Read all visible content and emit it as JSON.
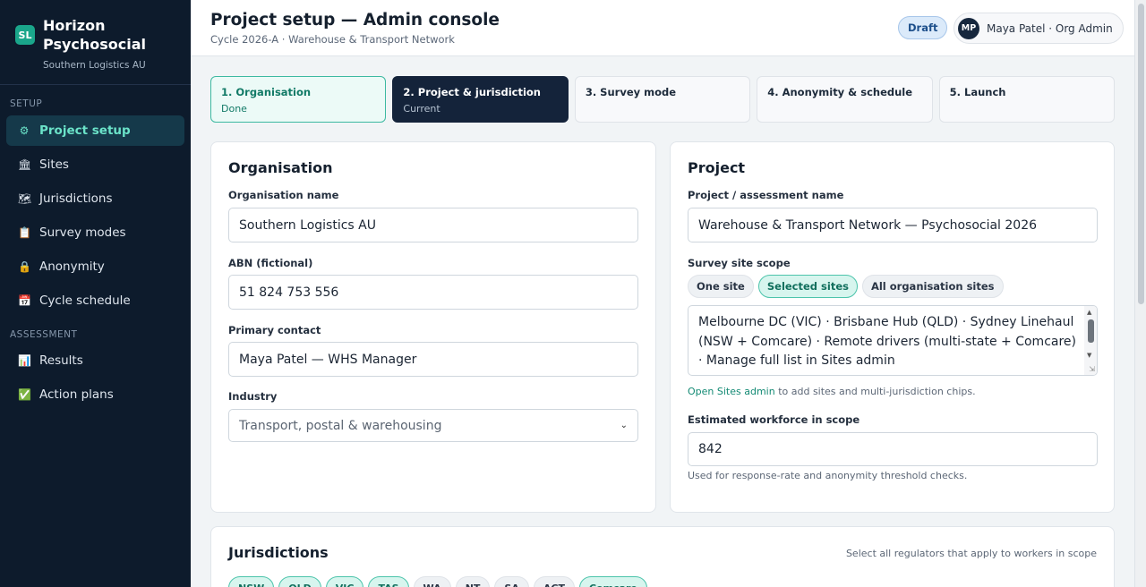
{
  "brand": {
    "logo": "SL",
    "name": "Horizon Psychosocial",
    "org": "Southern Logistics AU"
  },
  "sidebar": {
    "setup_section": "SETUP",
    "assessment_section": "ASSESSMENT",
    "setup_items": [
      {
        "label": "Project setup",
        "icon": "gear-icon",
        "glyph": "⚙",
        "active": true
      },
      {
        "label": "Sites",
        "icon": "building-icon",
        "glyph": "🏛"
      },
      {
        "label": "Jurisdictions",
        "icon": "map-icon",
        "glyph": "🗺"
      },
      {
        "label": "Survey modes",
        "icon": "clipboard-icon",
        "glyph": "📋"
      },
      {
        "label": "Anonymity",
        "icon": "lock-icon",
        "glyph": "🔒"
      },
      {
        "label": "Cycle schedule",
        "icon": "calendar-icon",
        "glyph": "📅"
      }
    ],
    "assessment_items": [
      {
        "label": "Results",
        "icon": "chart-icon",
        "glyph": "📊"
      },
      {
        "label": "Action plans",
        "icon": "check-icon",
        "glyph": "✅"
      }
    ]
  },
  "header": {
    "title": "Project setup — Admin console",
    "subtitle": "Cycle 2026-A · Warehouse & Transport Network",
    "status_badge": "Draft",
    "user_initials": "MP",
    "user_label": "Maya Patel · Org Admin"
  },
  "steps": [
    {
      "title": "1. Organisation",
      "status": "Done",
      "state": "done"
    },
    {
      "title": "2. Project & jurisdiction",
      "status": "Current",
      "state": "current"
    },
    {
      "title": "3. Survey mode",
      "status": "",
      "state": ""
    },
    {
      "title": "4. Anonymity & schedule",
      "status": "",
      "state": ""
    },
    {
      "title": "5. Launch",
      "status": "",
      "state": ""
    }
  ],
  "organisation": {
    "title": "Organisation",
    "name_label": "Organisation name",
    "name_value": "Southern Logistics AU",
    "abn_label": "ABN (fictional)",
    "abn_value": "51 824 753 556",
    "contact_label": "Primary contact",
    "contact_value": "Maya Patel — WHS Manager",
    "industry_label": "Industry",
    "industry_value": "Transport, postal & warehousing"
  },
  "project": {
    "title": "Project",
    "name_label": "Project / assessment name",
    "name_value": "Warehouse & Transport Network — Psychosocial 2026",
    "scope_label": "Survey site scope",
    "scope_options": [
      "One site",
      "Selected sites",
      "All organisation sites"
    ],
    "scope_selected": "Selected sites",
    "sites_text": "Melbourne DC (VIC) · Brisbane Hub (QLD) · Sydney Linehaul (NSW + Comcare) · Remote drivers (multi-state + Comcare) · Manage full list in Sites admin",
    "sites_hint_link": "Open Sites admin",
    "sites_hint_rest": " to add sites and multi-jurisdiction chips.",
    "workforce_label": "Estimated workforce in scope",
    "workforce_value": "842",
    "workforce_hint": "Used for response-rate and anonymity threshold checks."
  },
  "jurisdictions": {
    "title": "Jurisdictions",
    "hint": "Select all regulators that apply to workers in scope",
    "chips": [
      {
        "label": "NSW",
        "selected": true
      },
      {
        "label": "QLD",
        "selected": true
      },
      {
        "label": "VIC",
        "selected": true
      },
      {
        "label": "TAS",
        "selected": true
      },
      {
        "label": "WA",
        "selected": false
      },
      {
        "label": "NT",
        "selected": false
      },
      {
        "label": "SA",
        "selected": false
      },
      {
        "label": "ACT",
        "selected": false
      },
      {
        "label": "Comcare",
        "selected": true
      }
    ]
  },
  "colors": {
    "sidebar_bg": "#0d1b2c",
    "accent": "#1aa68b",
    "current_step": "#14233a"
  }
}
